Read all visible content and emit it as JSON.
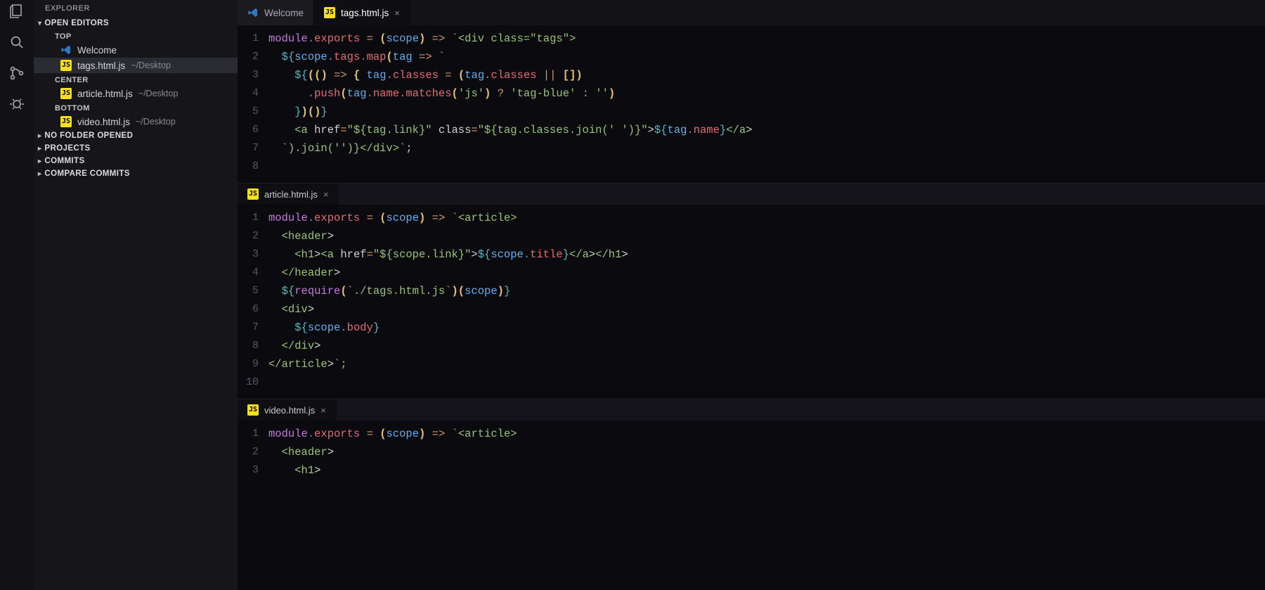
{
  "explorer": {
    "title": "EXPLORER",
    "sections": {
      "open_editors": {
        "label": "OPEN EDITORS",
        "groups": [
          {
            "name": "TOP",
            "items": [
              {
                "icon": "vscode",
                "label": "Welcome",
                "path": ""
              },
              {
                "icon": "js",
                "label": "tags.html.js",
                "path": "~/Desktop",
                "active": true
              }
            ]
          },
          {
            "name": "CENTER",
            "items": [
              {
                "icon": "js",
                "label": "article.html.js",
                "path": "~/Desktop"
              }
            ]
          },
          {
            "name": "BOTTOM",
            "items": [
              {
                "icon": "js",
                "label": "video.html.js",
                "path": "~/Desktop"
              }
            ]
          }
        ]
      },
      "collapsed": [
        "NO FOLDER OPENED",
        "PROJECTS",
        "COMMITS",
        "COMPARE COMMITS"
      ]
    }
  },
  "top_tabs": [
    {
      "icon": "vscode",
      "label": "Welcome",
      "closable": false,
      "active": false
    },
    {
      "icon": "js",
      "label": "tags.html.js",
      "closable": true,
      "active": true
    }
  ],
  "editor_groups": [
    {
      "tab": {
        "icon": "js",
        "label": "tags.html.js",
        "closable": true
      },
      "is_top": true,
      "lines": [
        "module.exports = (scope) => `<div class=\"tags\">",
        "  ${scope.tags.map(tag => `",
        "    ${(() => { tag.classes = (tag.classes || [])",
        "      .push(tag.name.matches('js') ? 'tag-blue' : '')",
        "    })()}",
        "    <a href=\"${tag.link}\" class=\"${tag.classes.join(' ')}\">${tag.name}</a>",
        "  `).join('')}</div>`;",
        ""
      ]
    },
    {
      "tab": {
        "icon": "js",
        "label": "article.html.js",
        "closable": true
      },
      "lines": [
        "module.exports = (scope) => `<article>",
        "  <header>",
        "    <h1><a href=\"${scope.link}\">${scope.title}</a></h1>",
        "  </header>",
        "  ${require(`./tags.html.js`)(scope)}",
        "  <div>",
        "    ${scope.body}",
        "  </div>",
        "</article>`;",
        ""
      ]
    },
    {
      "tab": {
        "icon": "js",
        "label": "video.html.js",
        "closable": true
      },
      "lines": [
        "module.exports = (scope) => `<article>",
        "  <header>",
        "    <h1>"
      ]
    }
  ],
  "syntax_colors": {
    "module": "#c678dd",
    "property": "#e06c75",
    "operator": "#d19a66",
    "paren": "#e5c07b",
    "variable": "#61afef",
    "string": "#98c379",
    "punctuation": "#888c96",
    "template": "#56b6c2"
  }
}
